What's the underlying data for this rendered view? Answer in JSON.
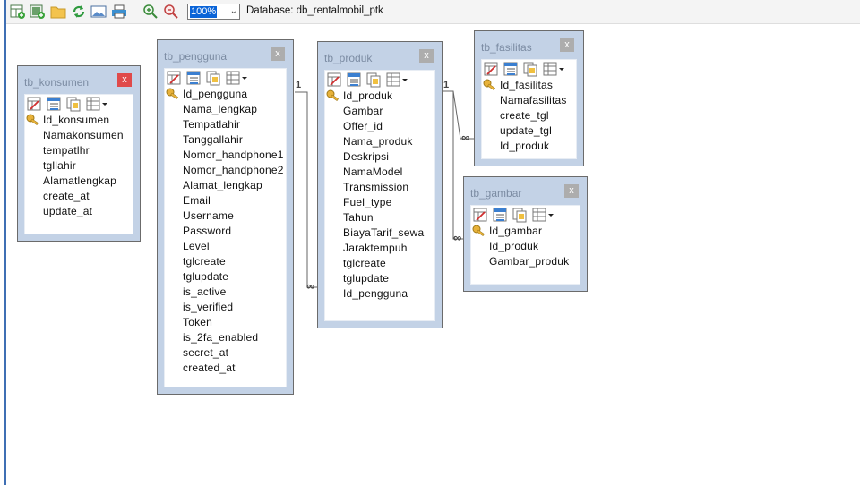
{
  "toolbar": {
    "icons": [
      "add-table-icon",
      "add-relation-icon",
      "open-folder-icon",
      "refresh-icon",
      "image-icon",
      "print-icon",
      "zoom-in-icon",
      "zoom-out-icon"
    ],
    "zoom": "100%",
    "database_label": "Database: db_rentalmobil_ptk"
  },
  "tables": {
    "tb_konsumen": {
      "title": "tb_konsumen",
      "close": "x",
      "fields": [
        "Id_konsumen",
        "Namakonsumen",
        "tempatlhr",
        "tgllahir",
        "Alamatlengkap",
        "create_at",
        "update_at"
      ]
    },
    "tb_pengguna": {
      "title": "tb_pengguna",
      "close": "x",
      "fields": [
        "Id_pengguna",
        "Nama_lengkap",
        "Tempatlahir",
        "Tanggallahir",
        "Nomor_handphone1",
        "Nomor_handphone2",
        "Alamat_lengkap",
        "Email",
        "Username",
        "Password",
        "Level",
        "tglcreate",
        "tglupdate",
        "is_active",
        "is_verified",
        "Token",
        "is_2fa_enabled",
        "secret_at",
        "created_at"
      ]
    },
    "tb_produk": {
      "title": "tb_produk",
      "close": "x",
      "fields": [
        "Id_produk",
        "Gambar",
        "Offer_id",
        "Nama_produk",
        "Deskripsi",
        "NamaModel",
        "Transmission",
        "Fuel_type",
        "Tahun",
        "BiayaTarif_sewa",
        "Jaraktempuh",
        "tglcreate",
        "tglupdate",
        "Id_pengguna"
      ]
    },
    "tb_fasilitas": {
      "title": "tb_fasilitas",
      "close": "x",
      "fields": [
        "Id_fasilitas",
        "Namafasilitas",
        "create_tgl",
        "update_tgl",
        "Id_produk"
      ]
    },
    "tb_gambar": {
      "title": "tb_gambar",
      "close": "x",
      "fields": [
        "Id_gambar",
        "Id_produk",
        "Gambar_produk"
      ]
    }
  },
  "relations": {
    "one": "1",
    "many": "∞"
  },
  "colors": {
    "table_header": "#c3d2e6",
    "close_active": "#e04a4a",
    "accent": "#3f6fb4"
  }
}
